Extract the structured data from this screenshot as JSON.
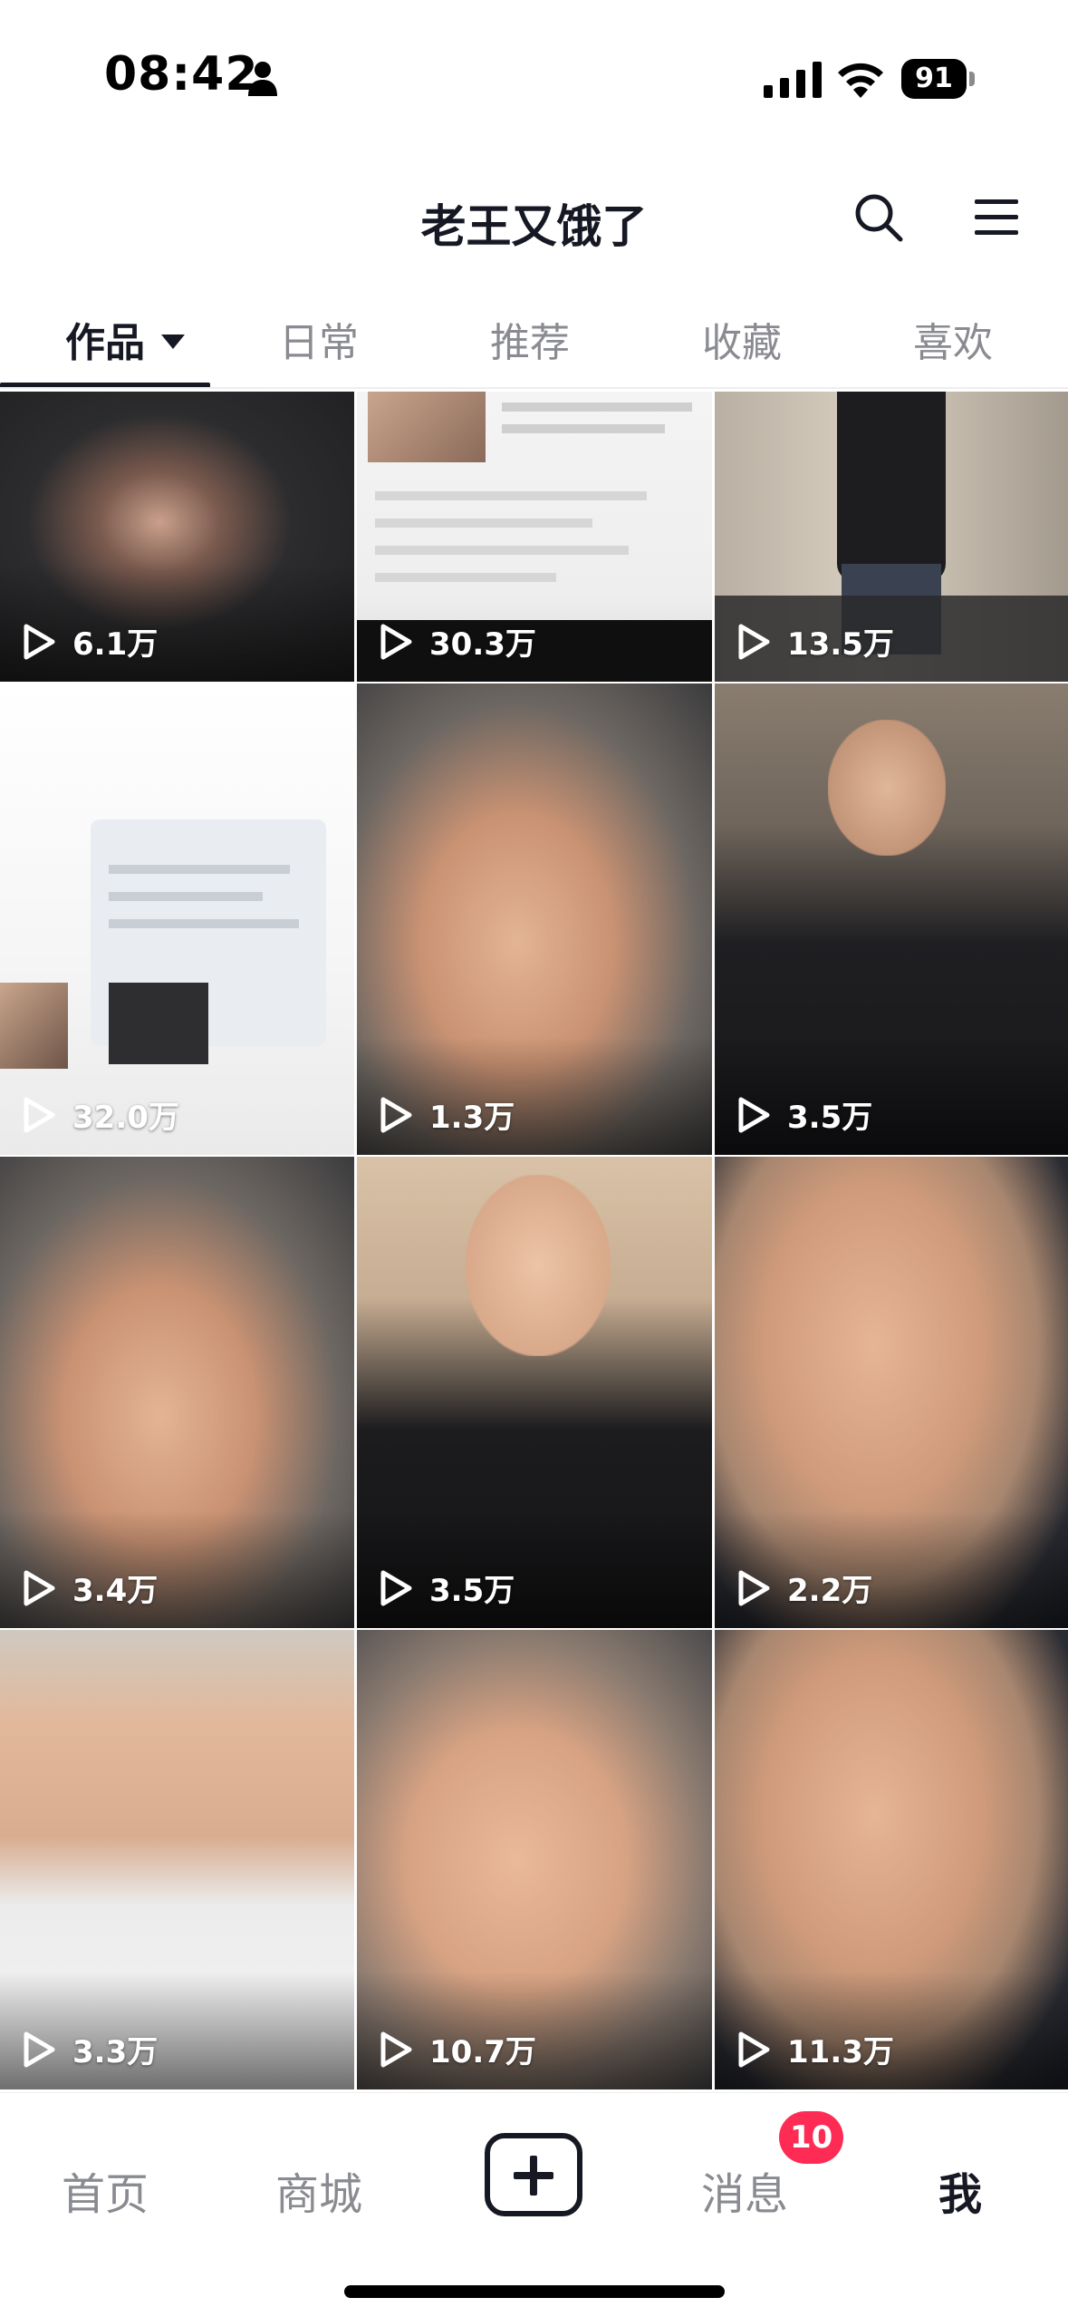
{
  "status_bar": {
    "time": "08:42",
    "battery": "91",
    "icons": [
      "person-icon",
      "signal-icon",
      "wifi-icon",
      "battery-icon"
    ]
  },
  "header": {
    "title": "老王又饿了",
    "icons": [
      "search-icon",
      "menu-icon"
    ]
  },
  "tabs": [
    {
      "label": "作品",
      "active": true
    },
    {
      "label": "日常",
      "active": false
    },
    {
      "label": "推荐",
      "active": false
    },
    {
      "label": "收藏",
      "active": false
    },
    {
      "label": "喜欢",
      "active": false
    }
  ],
  "videos": [
    {
      "views": "6.1万",
      "thumb": "dark"
    },
    {
      "views": "30.3万",
      "thumb": "screenshot"
    },
    {
      "views": "13.5万",
      "thumb": "hallway"
    },
    {
      "views": "32.0万",
      "thumb": "chat-screenshot"
    },
    {
      "views": "1.3万",
      "thumb": "skin"
    },
    {
      "views": "3.5万",
      "thumb": "dark-shirt"
    },
    {
      "views": "3.4万",
      "thumb": "skin"
    },
    {
      "views": "3.5万",
      "thumb": "dark-jacket"
    },
    {
      "views": "2.2万",
      "thumb": "skin-gym"
    },
    {
      "views": "3.3万",
      "thumb": "white-shirt"
    },
    {
      "views": "10.7万",
      "thumb": "skin"
    },
    {
      "views": "11.3万",
      "thumb": "skin-gym"
    }
  ],
  "bottom_nav": {
    "items": [
      {
        "label": "首页",
        "active": false
      },
      {
        "label": "商城",
        "active": false
      },
      {
        "label": "消息",
        "active": false
      },
      {
        "label": "我",
        "active": true
      }
    ],
    "badge": "10",
    "create_icon": "plus-icon"
  }
}
